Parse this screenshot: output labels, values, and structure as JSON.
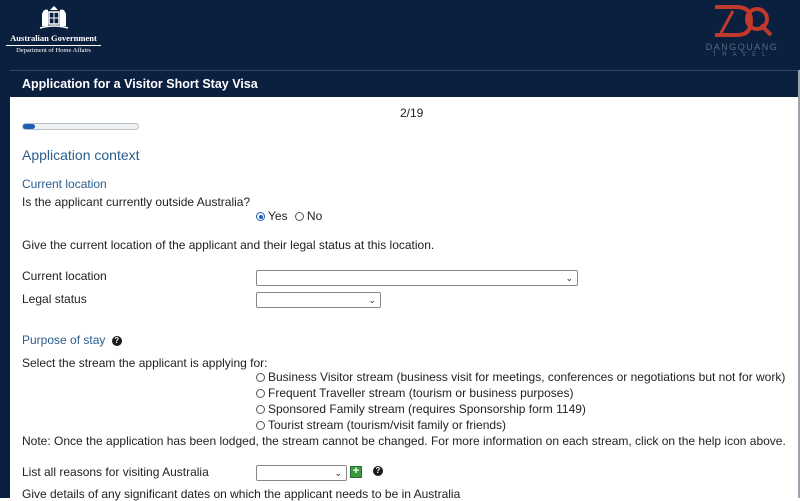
{
  "header": {
    "gov_line1": "Australian Government",
    "gov_line2": "Department of Home Affairs",
    "watermark_text": "DANGQUANG",
    "watermark_sub": "TRAVEL",
    "watermark_color": "#c0392b"
  },
  "page": {
    "title": "Application for a Visitor Short Stay Visa",
    "page_indicator": "2/19",
    "progress_fraction": 0.105
  },
  "section": {
    "title": "Application context",
    "current_location": {
      "heading": "Current location",
      "question": "Is the applicant currently outside Australia?",
      "yes_label": "Yes",
      "no_label": "No",
      "selected": "Yes",
      "instruction": "Give the current location of the applicant and their legal status at this location.",
      "location_label": "Current location",
      "location_value": "",
      "legal_status_label": "Legal status",
      "legal_status_value": ""
    },
    "purpose": {
      "heading": "Purpose of stay",
      "prompt": "Select the stream the applicant is applying for:",
      "streams": [
        "Business Visitor stream (business visit for meetings, conferences or negotiations but not for work)",
        "Frequent Traveller stream (tourism or business purposes)",
        "Sponsored Family stream (requires Sponsorship form 1149)",
        "Tourist stream (tourism/visit family or friends)"
      ],
      "note": "Note: Once the application has been lodged, the stream cannot be changed. For more information on each stream, click on the help icon above.",
      "reasons_label": "List all reasons for visiting Australia",
      "reasons_value": "",
      "dates_text": "Give details of any significant dates on which the applicant needs to be in Australia"
    }
  },
  "colors": {
    "header_bg": "#0b1f3f",
    "heading_blue": "#2a5d8f",
    "accent": "#1a5fb4",
    "add_green": "#3c9a3c"
  },
  "icons": {
    "help": "question-circle-icon",
    "add": "plus-square-icon",
    "select": "chevron-down-icon",
    "crest": "coat-of-arms-icon",
    "watermark": "dq-logo-icon"
  }
}
